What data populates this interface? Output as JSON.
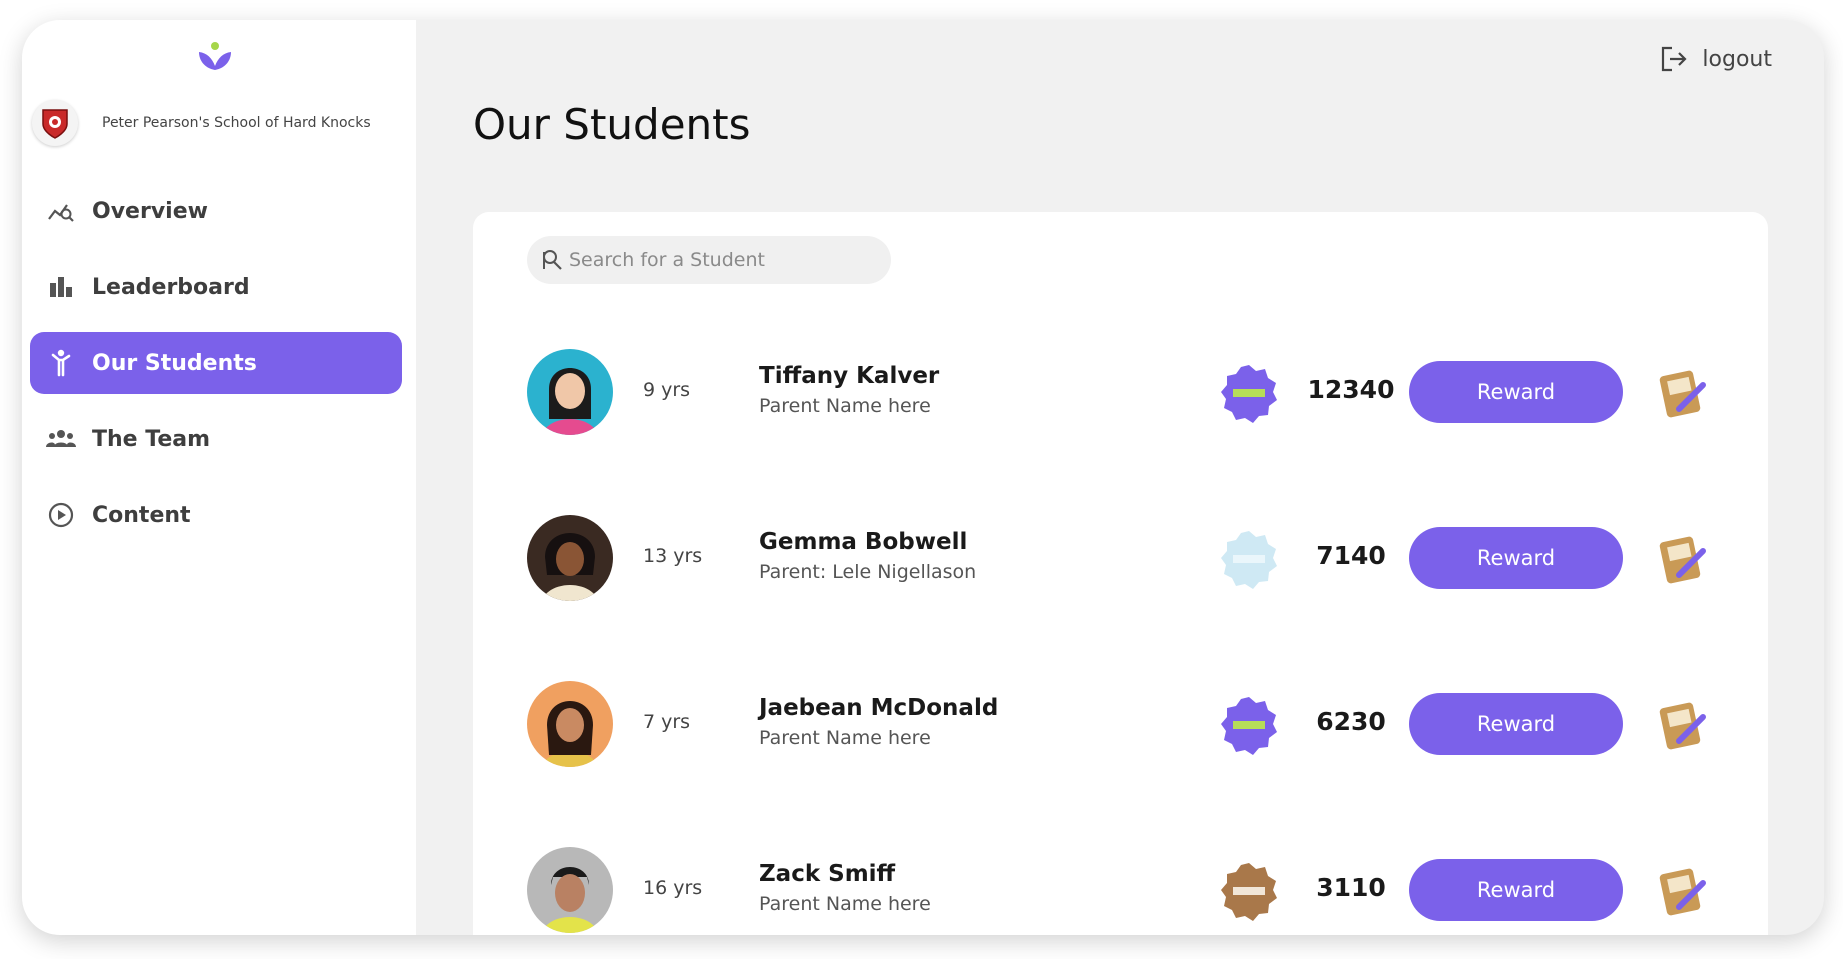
{
  "school": {
    "name": "Peter Pearson's School of Hard Knocks"
  },
  "sidebar": {
    "items": [
      {
        "label": "Overview",
        "icon": "chart-search-icon",
        "active": false
      },
      {
        "label": "Leaderboard",
        "icon": "bar-chart-icon",
        "active": false
      },
      {
        "label": "Our Students",
        "icon": "student-icon",
        "active": true
      },
      {
        "label": "The Team",
        "icon": "team-icon",
        "active": false
      },
      {
        "label": "Content",
        "icon": "play-circle-icon",
        "active": false
      }
    ]
  },
  "header": {
    "logout_label": "logout"
  },
  "main": {
    "title": "Our Students",
    "search": {
      "placeholder": "Search for a Student",
      "value": ""
    },
    "reward_label": "Reward",
    "students": [
      {
        "age": "9 yrs",
        "name": "Tiffany Kalver",
        "parent": "Parent Name here",
        "badge": "Newbie",
        "badge_color": "#7b61ea",
        "points": "12340"
      },
      {
        "age": "13 yrs",
        "name": "Gemma Bobwell",
        "parent": "Parent: Lele Nigellason",
        "badge": "Diamond",
        "badge_color": "#cfe9f4",
        "points": "7140"
      },
      {
        "age": "7 yrs",
        "name": "Jaebean McDonald",
        "parent": "Parent Name here",
        "badge": "Newbie",
        "badge_color": "#7b61ea",
        "points": "6230"
      },
      {
        "age": "16 yrs",
        "name": "Zack Smiff",
        "parent": "Parent Name here",
        "badge": "Bronze",
        "badge_color": "#a9784a",
        "points": "3110"
      }
    ]
  },
  "colors": {
    "accent": "#7b61ea",
    "background": "#f1f1f1",
    "card": "#ffffff"
  }
}
